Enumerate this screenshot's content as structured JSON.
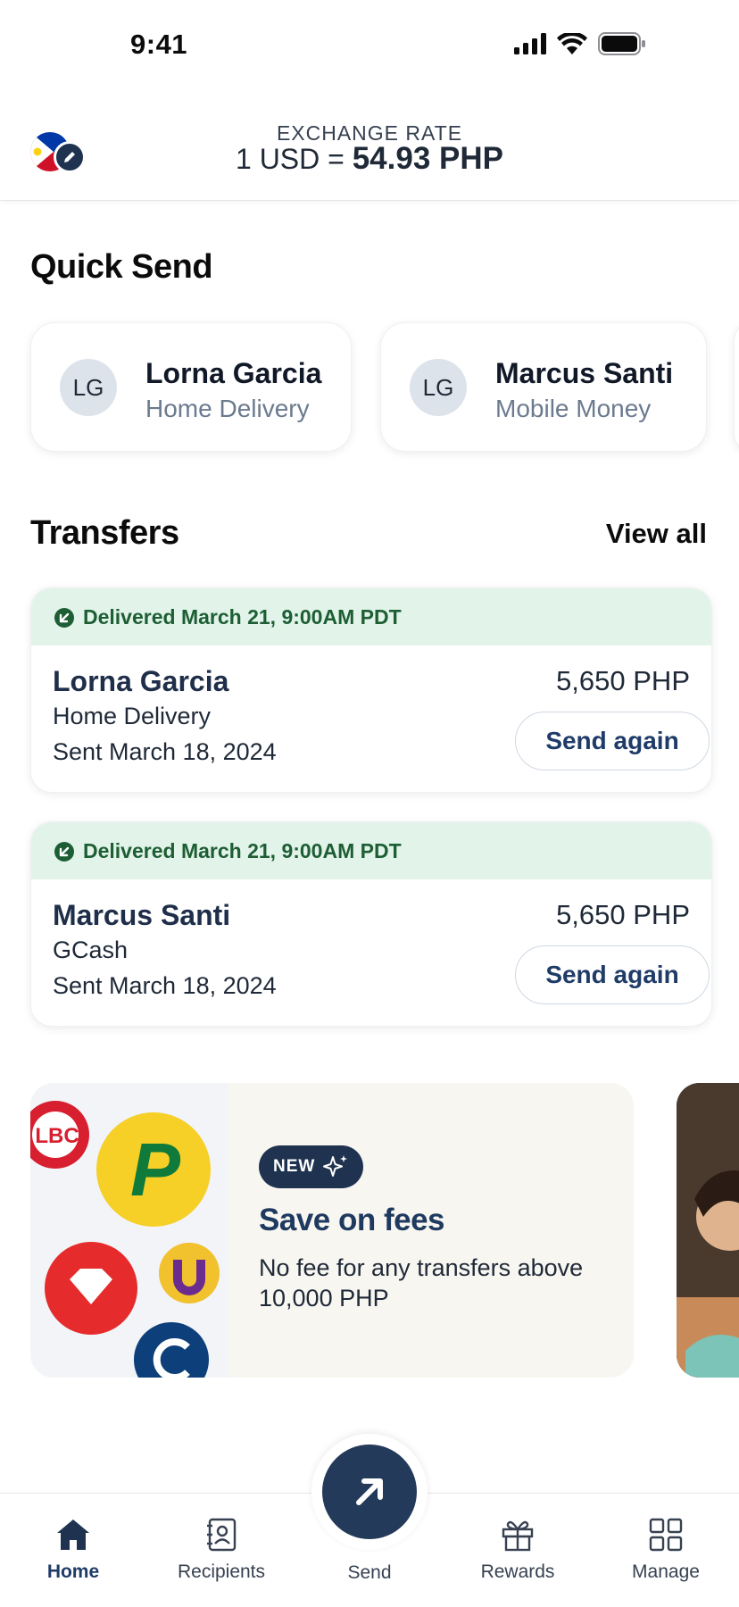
{
  "status_bar": {
    "time": "9:41"
  },
  "header": {
    "exchange_label": "EXCHANGE RATE",
    "exchange_prefix": "1 USD = ",
    "exchange_value": "54.93 PHP"
  },
  "quick_send": {
    "title": "Quick Send",
    "recipients": [
      {
        "initials": "LG",
        "name": "Lorna Garcia",
        "method": "Home Delivery"
      },
      {
        "initials": "LG",
        "name": "Marcus Santi",
        "method": "Mobile Money"
      }
    ]
  },
  "transfers": {
    "title": "Transfers",
    "view_all": "View all",
    "items": [
      {
        "status": "Delivered March 21, 9:00AM PDT",
        "name": "Lorna Garcia",
        "method": "Home Delivery",
        "sent": "Sent March 18, 2024",
        "amount": "5,650 PHP",
        "action": "Send again"
      },
      {
        "status": "Delivered March 21, 9:00AM PDT",
        "name": "Marcus Santi",
        "method": "GCash",
        "sent": "Sent March 18, 2024",
        "amount": "5,650 PHP",
        "action": "Send again"
      }
    ]
  },
  "promo": {
    "badge": "NEW",
    "title": "Save on fees",
    "text": "No fee for any transfers above 10,000 PHP",
    "logos": [
      "LBC",
      "P"
    ]
  },
  "nav": {
    "items": [
      {
        "label": "Home",
        "icon": "home-icon"
      },
      {
        "label": "Recipients",
        "icon": "contacts-icon"
      },
      {
        "label": "Send",
        "icon": "send-arrow-icon"
      },
      {
        "label": "Rewards",
        "icon": "gift-icon"
      },
      {
        "label": "Manage",
        "icon": "grid-icon"
      }
    ],
    "active": "Home"
  },
  "colors": {
    "primary": "#243a5a",
    "success_bg": "#e2f4ea",
    "success_text": "#1e5e34",
    "promo_bg": "#f8f6f1"
  }
}
